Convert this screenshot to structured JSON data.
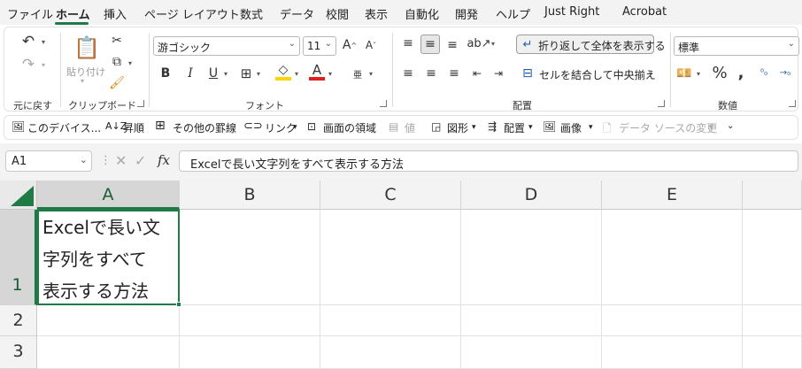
{
  "menu": {
    "tabs": [
      "ファイル",
      "ホーム",
      "挿入",
      "ページ レイアウト",
      "数式",
      "データ",
      "校閲",
      "表示",
      "自動化",
      "開発",
      "ヘルプ",
      "Just Right",
      "Acrobat"
    ],
    "active": "ホーム"
  },
  "ribbon": {
    "undo": {
      "label": "元に戻す"
    },
    "clipboard": {
      "label": "クリップボード",
      "paste_label": "貼り付け"
    },
    "font": {
      "label": "フォント",
      "family": "游ゴシック",
      "size": "11"
    },
    "alignment": {
      "label": "配置",
      "wrap_text": "折り返して全体を表示する",
      "merge_center": "セルを結合して中央揃え"
    },
    "number": {
      "label": "数値",
      "format": "標準"
    }
  },
  "qat": {
    "items": [
      "このデバイス...",
      "昇順",
      "その他の罫線",
      "リンク",
      "画面の領域",
      "値",
      "図形",
      "配置",
      "画像",
      "データ ソースの変更"
    ]
  },
  "formula_bar": {
    "name_box": "A1",
    "content": "Excelで長い文字列をすべて表示する方法"
  },
  "sheet": {
    "columns": [
      "A",
      "B",
      "C",
      "D",
      "E"
    ],
    "rows": [
      "1",
      "2",
      "3"
    ],
    "a1_lines": [
      "Excelで長い文",
      "字列をすべて",
      "表示する方法"
    ]
  },
  "colors": {
    "accent": "#1f7a45",
    "selected_header": "#d6d6d6"
  }
}
